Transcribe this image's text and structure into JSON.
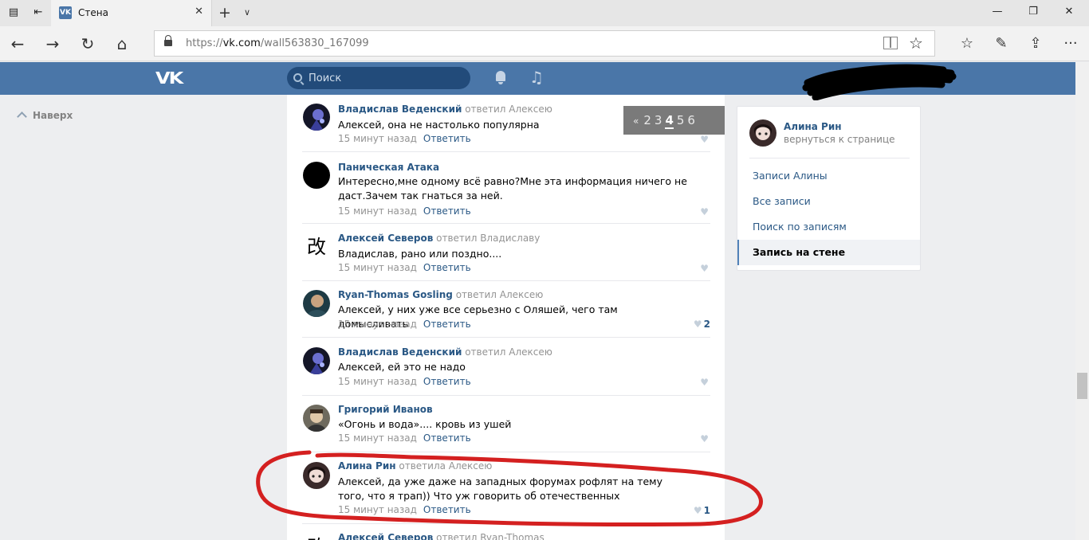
{
  "browser": {
    "tab_title": "Стена",
    "favicon_text": "VK",
    "url_prefix": "https://",
    "url_host": "vk.com",
    "url_path": "/wall563830_167099"
  },
  "header": {
    "logo": "VK",
    "search_placeholder": "Поиск"
  },
  "back_to_top": "Наверх",
  "pager": {
    "prev": "«",
    "pages": [
      "2",
      "3",
      "4",
      "5",
      "6"
    ],
    "current": "4"
  },
  "comments": [
    {
      "author": "Владислав Веденский",
      "reply": "ответил Алексею",
      "text": "Алексей, она не настолько популярна",
      "time": "15 минут назад",
      "answer": "Ответить",
      "likes": ""
    },
    {
      "author": "Паническая Атака",
      "reply": "",
      "text": "Интересно,мне одному всё равно?Мне эта информация ничего не даст.Зачем так гнаться за ней.",
      "time": "15 минут назад",
      "answer": "Ответить",
      "likes": ""
    },
    {
      "author": "Алексей Северов",
      "reply": "ответил Владиславу",
      "text": "Владислав, рано или поздно....",
      "time": "15 минут назад",
      "answer": "Ответить",
      "likes": ""
    },
    {
      "author": "Ryan-Thomas Gosling",
      "reply": "ответил Алексею",
      "text": "Алексей, у них уже все серьезно с Оляшей, чего там домысливать",
      "time": "15 минут назад",
      "answer": "Ответить",
      "likes": "2"
    },
    {
      "author": "Владислав Веденский",
      "reply": "ответил Алексею",
      "text": "Алексей, ей это не надо",
      "time": "15 минут назад",
      "answer": "Ответить",
      "likes": ""
    },
    {
      "author": "Григорий Иванов",
      "reply": "",
      "text": "«Огонь и вода».... кровь из ушей",
      "time": "15 минут назад",
      "answer": "Ответить",
      "likes": ""
    },
    {
      "author": "Алина Рин",
      "reply": "ответила Алексею",
      "text": "Алексей, да уже даже на западных форумах рофлят на тему того, что я трап)) Что уж говорить об отечественных",
      "time": "15 минут назад",
      "answer": "Ответить",
      "likes": "1"
    },
    {
      "author": "Алексей Северов",
      "reply": "ответил Ryan-Thomas",
      "text": "",
      "time": "",
      "answer": "",
      "likes": ""
    }
  ],
  "sidebar": {
    "name": "Алина Рин",
    "back": "вернуться к странице",
    "items": [
      "Записи Алины",
      "Все записи",
      "Поиск по записям",
      "Запись на стене"
    ],
    "active_index": 3
  },
  "colors": {
    "vk_blue": "#4a76a8",
    "link": "#2a5885",
    "annotation_red": "#d42020"
  }
}
